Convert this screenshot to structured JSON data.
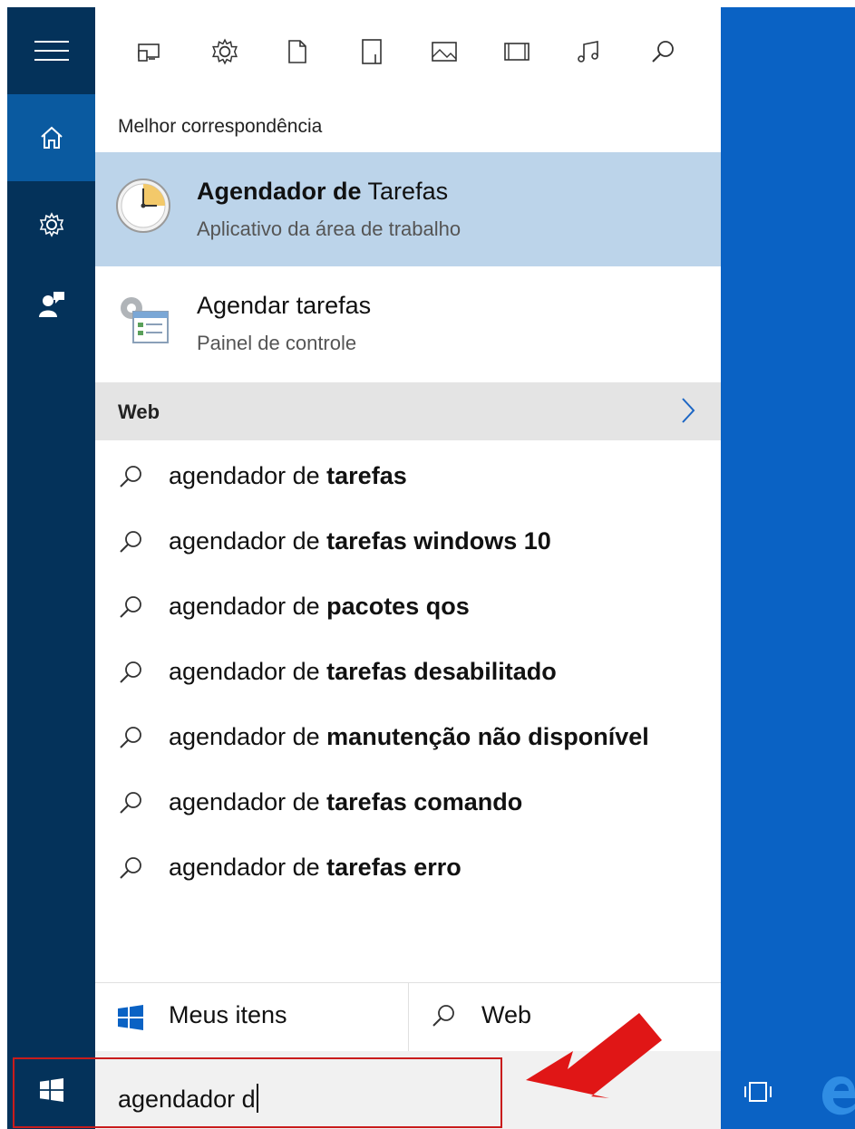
{
  "sidebar": {
    "items": [
      {
        "name": "menu"
      },
      {
        "name": "home",
        "active": true
      },
      {
        "name": "settings"
      },
      {
        "name": "feedback"
      }
    ]
  },
  "filter_bar": {
    "icons": [
      "apps-icon",
      "settings-icon",
      "documents-icon",
      "folders-icon",
      "photos-icon",
      "videos-icon",
      "music-icon",
      "web-search-icon"
    ]
  },
  "best_match": {
    "label": "Melhor correspondência",
    "title_bold": "Agendador d",
    "title_highlight": "e",
    "title_rest": " Tarefas",
    "subtitle": "Aplicativo da área de trabalho"
  },
  "second_result": {
    "title": "Agendar tarefas",
    "subtitle": "Painel de controle"
  },
  "web": {
    "label": "Web",
    "prefix": "agendador de",
    "suggestions": [
      {
        "bold": "tarefas"
      },
      {
        "bold": "tarefas windows 10"
      },
      {
        "bold": "pacotes qos"
      },
      {
        "bold": "tarefas desabilitado"
      },
      {
        "bold": "manutenção não disponível"
      },
      {
        "bold": "tarefas comando"
      },
      {
        "bold": "tarefas erro"
      }
    ]
  },
  "scope": {
    "my_items": "Meus itens",
    "web": "Web"
  },
  "search": {
    "value": "agendador d"
  },
  "colors": {
    "rail": "#04325a",
    "rail_active": "#0a5aa0",
    "desktop_blue": "#0a62c4",
    "selected_row": "#bcd4ea",
    "annotation_red": "#c91c1c"
  }
}
